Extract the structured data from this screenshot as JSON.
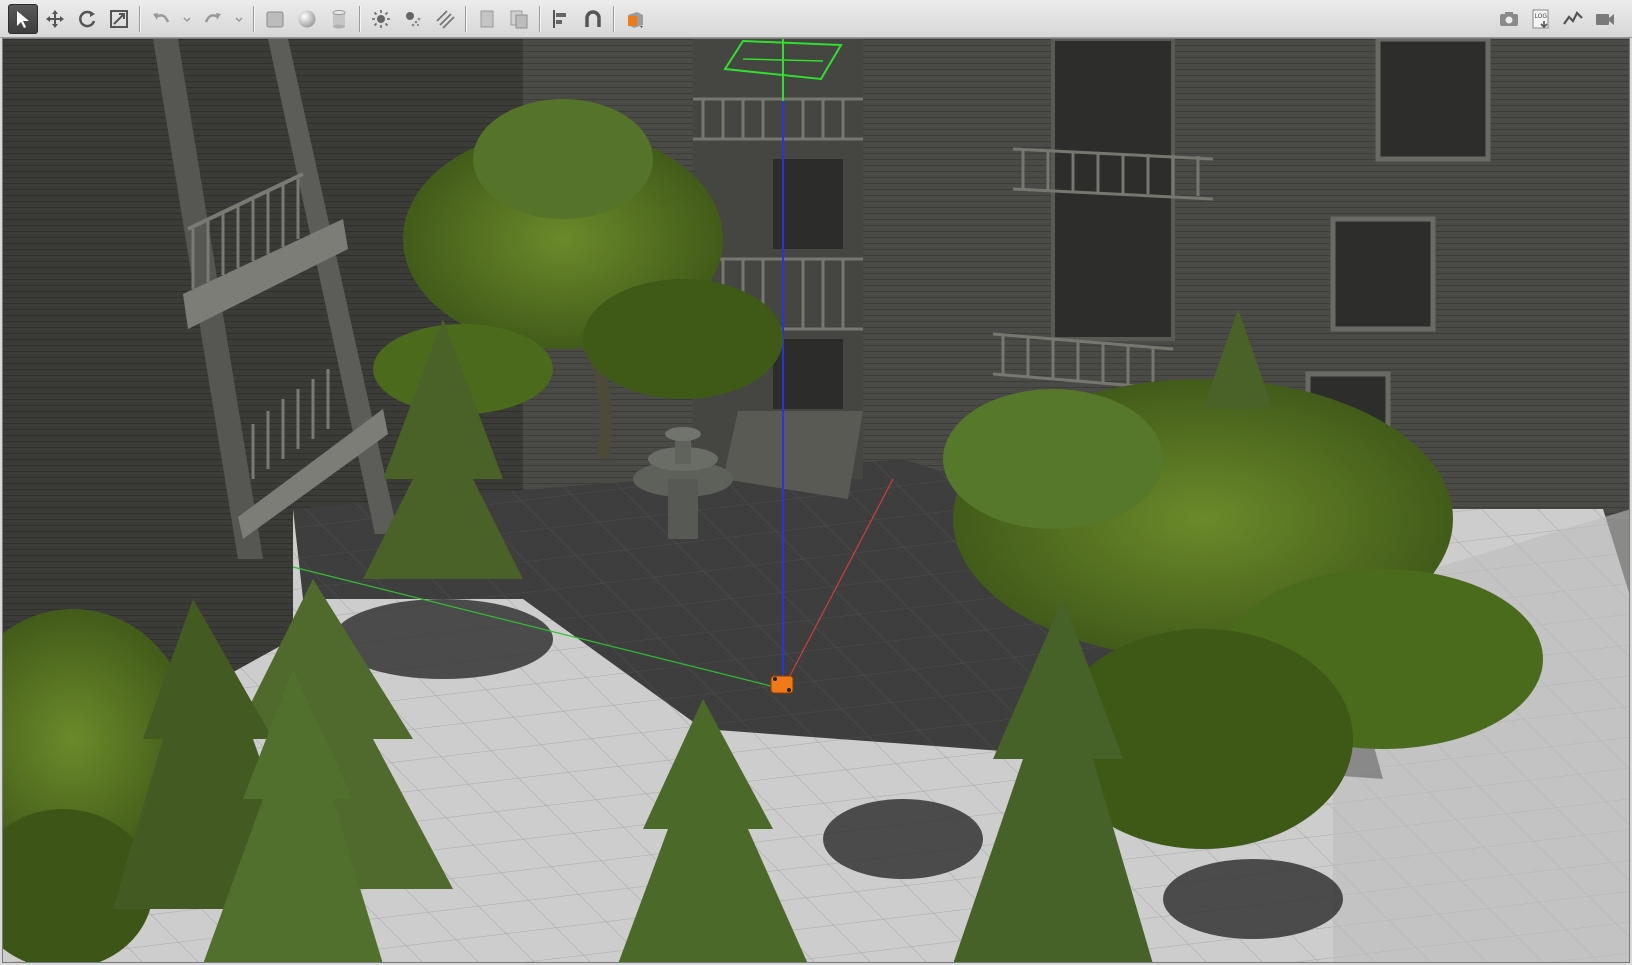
{
  "toolbar": {
    "left_tools": [
      {
        "name": "select-tool",
        "icon": "arrow-cursor-icon",
        "active": true
      },
      {
        "name": "translate-tool",
        "icon": "move-arrows-icon"
      },
      {
        "name": "rotate-tool",
        "icon": "rotate-icon"
      },
      {
        "name": "scale-tool",
        "icon": "scale-icon"
      },
      {
        "name": "undo",
        "icon": "undo-icon"
      },
      {
        "name": "redo",
        "icon": "redo-icon"
      },
      {
        "name": "box-shape",
        "icon": "box-icon"
      },
      {
        "name": "sphere-shape",
        "icon": "sphere-icon"
      },
      {
        "name": "cylinder-shape",
        "icon": "cylinder-icon"
      },
      {
        "name": "point-light",
        "icon": "sun-icon"
      },
      {
        "name": "spot-light",
        "icon": "spot-light-icon"
      },
      {
        "name": "directional-light",
        "icon": "directional-light-icon"
      },
      {
        "name": "copy",
        "icon": "copy-icon"
      },
      {
        "name": "paste",
        "icon": "paste-icon"
      },
      {
        "name": "align",
        "icon": "align-icon"
      },
      {
        "name": "snap",
        "icon": "magnet-icon"
      },
      {
        "name": "view-angle",
        "icon": "view-cube-icon"
      }
    ],
    "right_tools": [
      {
        "name": "screenshot",
        "icon": "camera-icon"
      },
      {
        "name": "log",
        "icon": "log-icon",
        "label": "LOG"
      },
      {
        "name": "plot",
        "icon": "plot-icon"
      },
      {
        "name": "video-record",
        "icon": "video-camera-icon"
      }
    ]
  },
  "colors": {
    "toolbar_bg": "#dedede",
    "accent_orange": "#f07a1a",
    "axis_x": "#d03c3c",
    "axis_y": "#2fbf2f",
    "axis_z": "#2436e0",
    "ground_dark": "#3c3c3c",
    "ground_light": "#cfcfcf"
  }
}
